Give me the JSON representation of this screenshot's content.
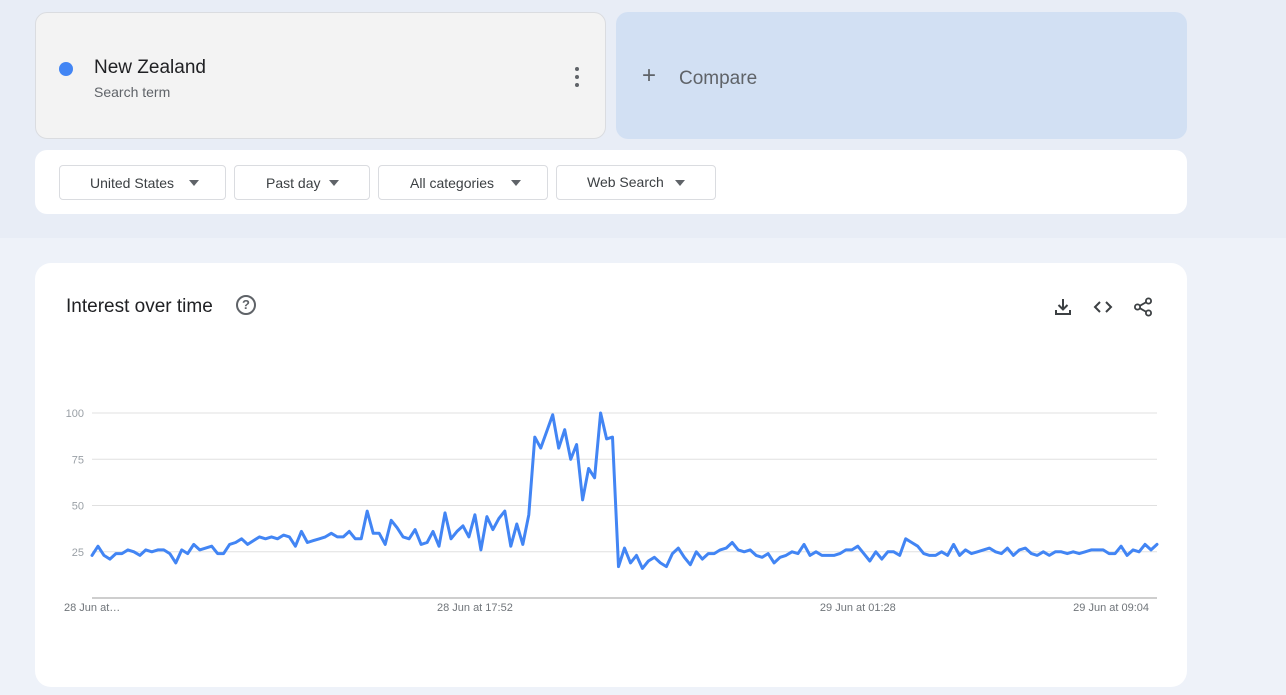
{
  "search_term": {
    "name": "New Zealand",
    "subtitle": "Search term",
    "color": "#4285f4",
    "menu_icon": "more-vert-icon"
  },
  "compare": {
    "label": "Compare",
    "icon": "plus-icon"
  },
  "filters": {
    "region": "United States",
    "time_range": "Past day",
    "category": "All categories",
    "search_type": "Web Search"
  },
  "chart": {
    "title": "Interest over time",
    "help_icon": "help-circle-icon",
    "actions": [
      "download-icon",
      "embed-code-icon",
      "share-icon"
    ]
  },
  "chart_data": {
    "type": "line",
    "title": "Interest over time",
    "xlabel": "",
    "ylabel": "",
    "ylim": [
      0,
      100
    ],
    "yticks": [
      25,
      50,
      75,
      100
    ],
    "grid": true,
    "x_ticks": [
      {
        "label": "28 Jun at…",
        "index": 0
      },
      {
        "label": "28 Jun at 17:52",
        "index": 64
      },
      {
        "label": "29 Jun at 01:28",
        "index": 128
      },
      {
        "label": "29 Jun at 09:04",
        "index": 191
      }
    ],
    "series": [
      {
        "color": "#4285f4",
        "values": [
          23,
          28,
          23,
          21,
          24,
          24,
          26,
          25,
          23,
          26,
          25,
          26,
          26,
          24,
          19,
          26,
          24,
          29,
          26,
          27,
          28,
          24,
          24,
          29,
          30,
          32,
          29,
          31,
          33,
          32,
          33,
          32,
          34,
          33,
          28,
          36,
          30,
          31,
          32,
          33,
          35,
          33,
          33,
          36,
          32,
          32,
          47,
          35,
          35,
          29,
          42,
          38,
          33,
          32,
          37,
          29,
          30,
          36,
          28,
          46,
          32,
          36,
          39,
          33,
          45,
          26,
          44,
          37,
          43,
          47,
          28,
          40,
          29,
          45,
          87,
          81,
          90,
          99,
          81,
          91,
          75,
          83,
          53,
          70,
          65,
          100,
          86,
          87,
          17,
          27,
          19,
          23,
          16,
          20,
          22,
          19,
          17,
          24,
          27,
          22,
          18,
          25,
          21,
          24,
          24,
          26,
          27,
          30,
          26,
          25,
          26,
          23,
          22,
          24,
          19,
          22,
          23,
          25,
          24,
          29,
          23,
          25,
          23,
          23,
          23,
          24,
          26,
          26,
          28,
          24,
          20,
          25,
          21,
          25,
          25,
          23,
          32,
          30,
          28,
          24,
          23,
          23,
          25,
          23,
          29,
          23,
          26,
          24,
          25,
          26,
          27,
          25,
          24,
          27,
          23,
          26,
          27,
          24,
          23,
          25,
          23,
          25,
          25,
          24,
          25,
          24,
          25,
          26,
          26,
          26,
          24,
          24,
          28,
          23,
          26,
          25,
          29,
          26,
          29
        ]
      }
    ]
  }
}
